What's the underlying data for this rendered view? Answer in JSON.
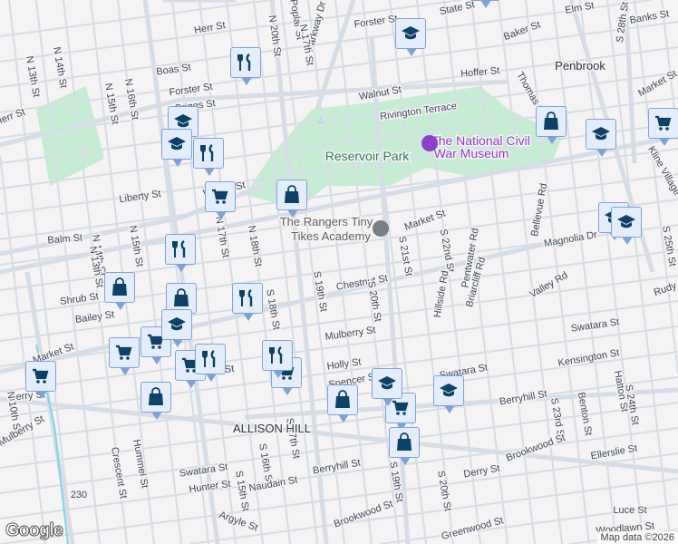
{
  "map": {
    "area_label": "ALLISON HILL",
    "town_label": "Penbrook",
    "park_label": "Reservoir Park",
    "museum_label_1": "The National Civil",
    "museum_label_2": "War Museum",
    "poi_label_1": "The Rangers Tiny",
    "poi_label_2": "Tikes Academy",
    "route_shield": "230",
    "streets": [
      "Herr St",
      "N 20th St",
      "Poplar St",
      "Parkway Dr",
      "Forster St",
      "State St",
      "Baker St",
      "Elm St",
      "Banks St",
      "S 28th St",
      "Hoffer St",
      "Thomas St",
      "Market St",
      "Walnut St",
      "Rivington Terrace",
      "Boas St",
      "Forster St",
      "Briggs St",
      "N 13th St",
      "N 14th St",
      "N 15th St",
      "N 16th St",
      "Herr St",
      "Liberty St",
      "Walnut St",
      "N 15th St",
      "N 14th St",
      "N 13th St",
      "N 18th St",
      "N 17th St",
      "Market St",
      "S 21st St",
      "S 22nd St",
      "Pentwater Rd",
      "Briarcliff Rd",
      "Bellevue Rd",
      "Magnolia Dr",
      "Valley Rd",
      "Rudy",
      "Kline Village",
      "S 25th St",
      "Chestnut St",
      "S 20th St",
      "S 19th St",
      "S 18th St",
      "Hillside Rd",
      "Balm St",
      "Shrub St",
      "Bailey St",
      "Market St",
      "Mulberry St",
      "Swatara St",
      "Kensington St",
      "Holly St",
      "Swatara St",
      "Spencer St",
      "Berryhill St",
      "Derry St",
      "N 10th St",
      "S 17th St",
      "S 19th St",
      "Hatton St",
      "S 24th St",
      "Benton St",
      "S 23rd St",
      "Brookwood St",
      "Ellerslie St",
      "Derry St",
      "S 20th St",
      "Mulberry St",
      "Crescent St",
      "Hummel St",
      "Swatara St",
      "Hunter St",
      "S 15th St",
      "S 16th St",
      "Berryhill St",
      "Naudain St",
      "Argyle St",
      "Brookwood St",
      "Greenwood St",
      "Luce St",
      "Woodlawn St",
      "Paxton St",
      "N 17th St"
    ]
  },
  "markers_legend": {
    "grocery": "cart-icon",
    "shopping": "bag-icon",
    "school": "school-icon",
    "restaurant": "restaurant-icon"
  },
  "colors": {
    "marker_fill": "#e3edfb",
    "marker_border": "#7ea2d8",
    "icon": "#0d4166",
    "park": "#c6ecd3",
    "museum": "#8e3fd0"
  },
  "footer": {
    "logo": "Google",
    "attribution": "Map data ©2026"
  }
}
